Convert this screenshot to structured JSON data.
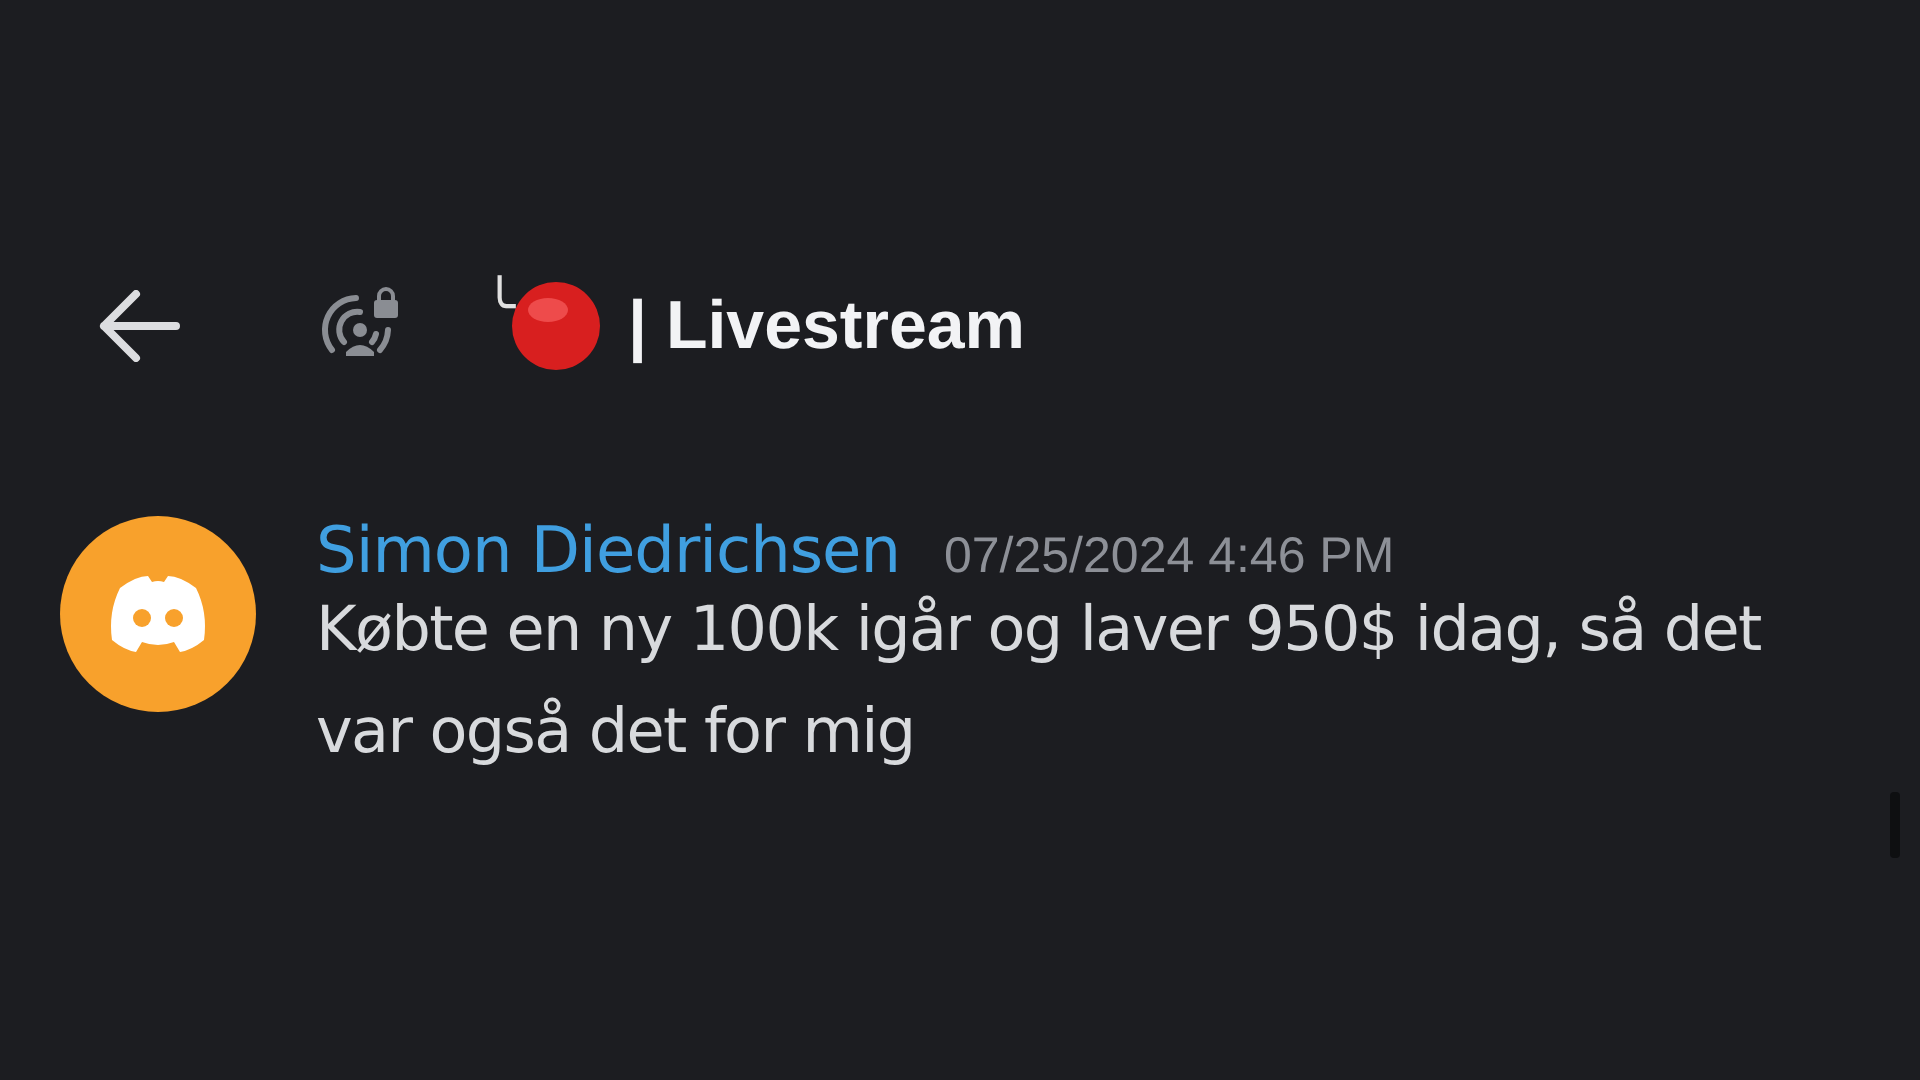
{
  "header": {
    "channel_prefix": "╰",
    "channel_name": "| Livestream"
  },
  "messages": [
    {
      "author": "Simon Diedrichsen",
      "timestamp": "07/25/2024 4:46 PM",
      "text": "Købte en ny 100k igår og laver 950$ idag, så det var også det for mig"
    }
  ]
}
